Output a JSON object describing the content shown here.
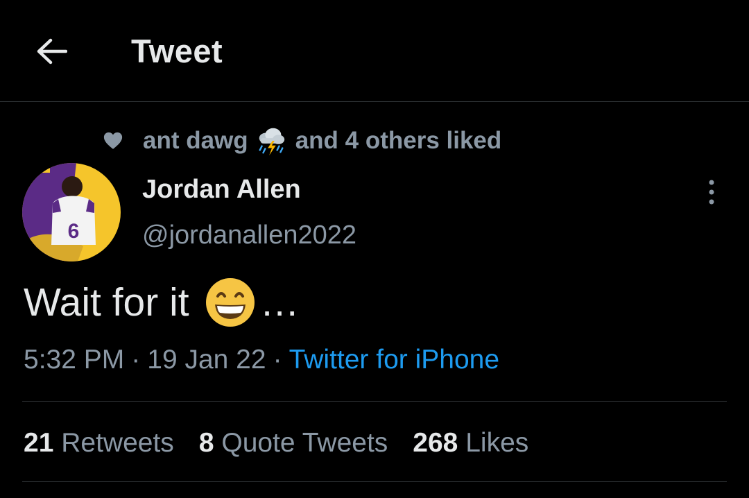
{
  "header": {
    "back_icon": "arrow-left-icon",
    "title": "Tweet"
  },
  "social_context": {
    "icon": "heart-icon",
    "user": "ant dawg",
    "emoji": "cloud-with-lightning-and-rain-icon",
    "suffix": "and 4 others liked"
  },
  "tweet": {
    "author_name": "Jordan Allen",
    "author_handle": "@jordanallen2022",
    "text": "Wait for it",
    "emoji": "grinning-face-icon",
    "text_suffix": "…",
    "time": "5:32 PM",
    "separator": "·",
    "date": "19 Jan 22",
    "source": "Twitter for iPhone"
  },
  "stats": {
    "retweets_count": "21",
    "retweets_label": "Retweets",
    "quotes_count": "8",
    "quotes_label": "Quote Tweets",
    "likes_count": "268",
    "likes_label": "Likes"
  },
  "colors": {
    "background": "#000000",
    "primary_text": "#e7e9ea",
    "secondary_text": "#8b98a5",
    "link": "#1d9bf0",
    "divider": "#2f3336",
    "avatar_purple": "#5b2b86",
    "avatar_gold": "#f5c52b"
  }
}
